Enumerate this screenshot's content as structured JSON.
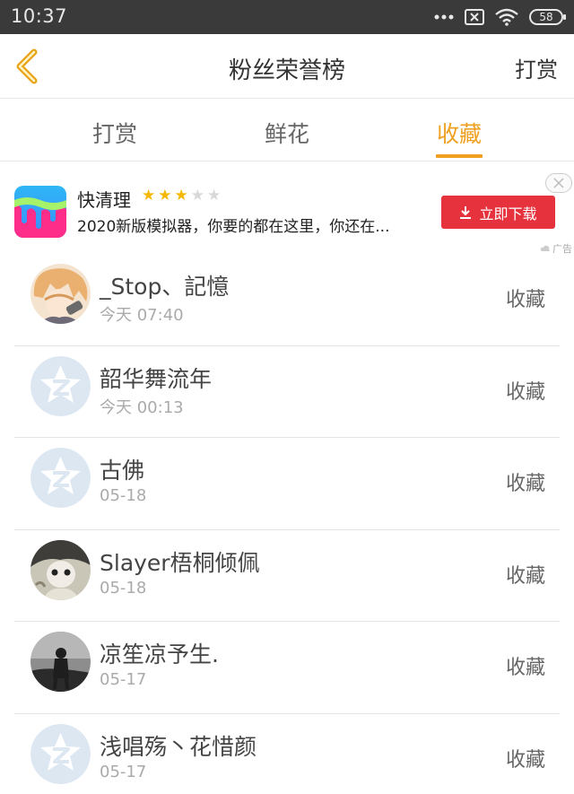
{
  "status_bar": {
    "time": "10:37",
    "battery": "58",
    "icons": [
      "more-dots-icon",
      "sim-off-icon",
      "wifi-icon",
      "battery-icon"
    ]
  },
  "nav": {
    "title": "粉丝荣誉榜",
    "action": "打赏",
    "back_icon": "chevron-left-icon",
    "accent": "#f0a020"
  },
  "tabs": [
    {
      "label": "打赏"
    },
    {
      "label": "鲜花"
    },
    {
      "label": "收藏"
    }
  ],
  "active_tab": 2,
  "ad": {
    "name": "快清理",
    "rating": 3,
    "rating_max": 5,
    "description": "2020新版模拟器，你要的都在这里，你还在...",
    "button_label": "立即下载",
    "tag": "广告",
    "button_color": "#e5323d"
  },
  "list": [
    {
      "name": "_Stop、記憶",
      "time": "今天 07:40",
      "action": "收藏",
      "avatar": "anime-avatar"
    },
    {
      "name": "韶华舞流年",
      "time": "今天 00:13",
      "action": "收藏",
      "avatar": "default-avatar"
    },
    {
      "name": "古佛",
      "time": "05-18",
      "action": "收藏",
      "avatar": "default-avatar"
    },
    {
      "name": "Slayer梧桐倾佩",
      "time": "05-18",
      "action": "收藏",
      "avatar": "doll-avatar"
    },
    {
      "name": "凉笙凉予生.",
      "time": "05-17",
      "action": "收藏",
      "avatar": "photo-avatar"
    },
    {
      "name": "浅唱殇丶花惜颜",
      "time": "05-17",
      "action": "收藏",
      "avatar": "default-avatar"
    }
  ]
}
